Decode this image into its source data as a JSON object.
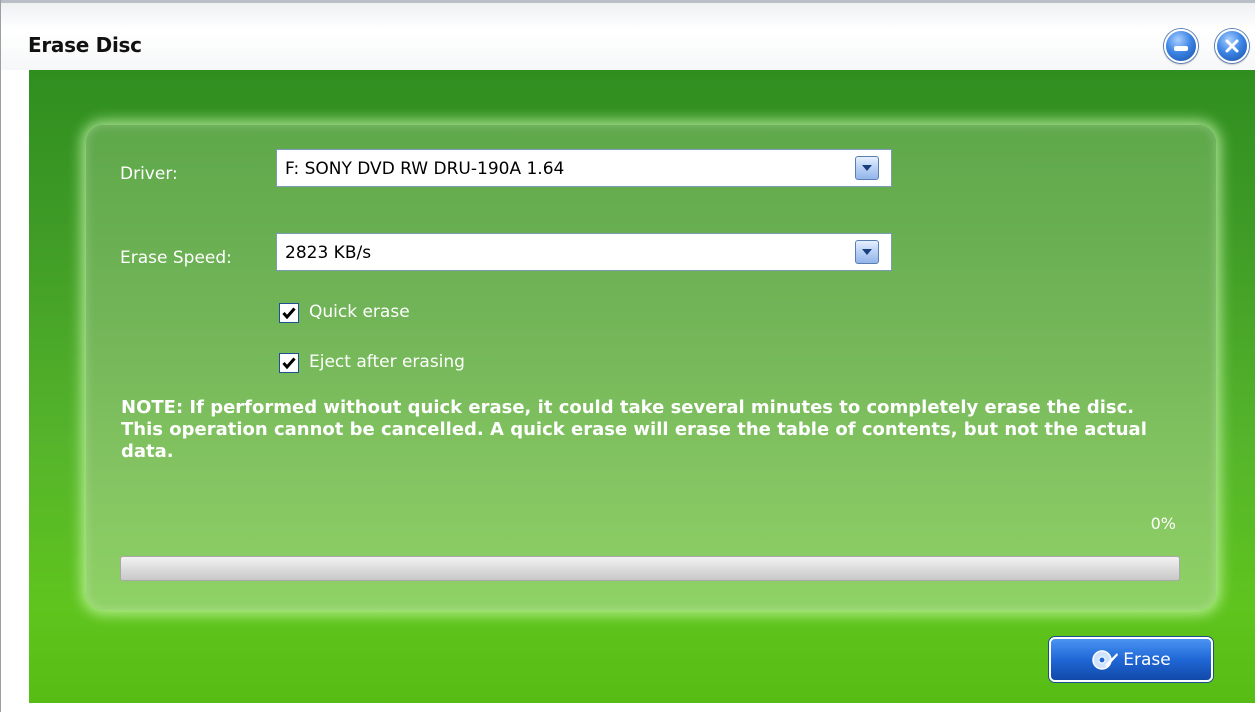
{
  "window": {
    "title": "Erase Disc",
    "minimize_icon": "minimize-icon",
    "close_icon": "close-icon"
  },
  "form": {
    "driver_label": "Driver:",
    "driver_value": "F: SONY DVD RW DRU-190A 1.64",
    "speed_label": "Erase Speed:",
    "speed_value": "2823 KB/s",
    "quick_erase_label": "Quick erase",
    "quick_erase_checked": true,
    "eject_label": "Eject after erasing",
    "eject_checked": true
  },
  "note": "NOTE: If performed without quick erase, it could take several minutes to completely erase the disc. This operation cannot be cancelled. A quick erase will erase the table of contents, but not the actual data.",
  "progress": {
    "percent_text": "0%",
    "value": 0
  },
  "actions": {
    "erase_label": "Erase",
    "erase_icon": "erase-disc-icon"
  },
  "colors": {
    "accent_green": "#4fae22",
    "button_blue": "#2067d6"
  }
}
